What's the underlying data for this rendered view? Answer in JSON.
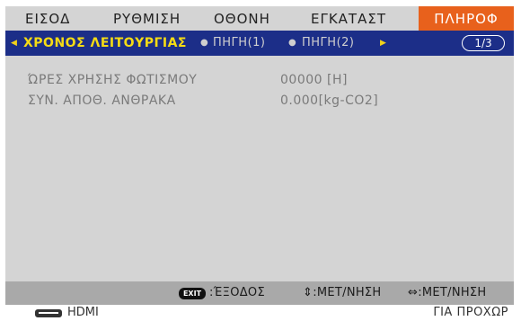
{
  "tabs": [
    {
      "label": "ΕΙΣΟΔ"
    },
    {
      "label": "ΡΥΘΜΙΣΗ"
    },
    {
      "label": "ΟΘΟΝΗ"
    },
    {
      "label": "ΕΓΚΑΤΑΣΤ"
    },
    {
      "label": "ΠΛΗΡΟΦ"
    }
  ],
  "active_tab": "ΠΛΗΡΟΦ",
  "subtabs": {
    "current": "ΧΡΟΝΟΣ ΛΕΙΤΟΥΡΓΙΑΣ",
    "others": [
      "ΠΗΓΗ(1)",
      "ΠΗΓΗ(2)"
    ],
    "page": "1/3"
  },
  "info": [
    {
      "label": "ΏΡΕΣ ΧΡΗΣΗΣ ΦΩΤΙΣΜΟΥ",
      "value": "00000  [H]"
    },
    {
      "label": "ΣΥΝ. ΑΠΟΘ. ΑΝΘΡΑΚΑ",
      "value": "0.000[kg-CO2]"
    }
  ],
  "footer": {
    "exit_key": "EXIT",
    "exit_label": ":ΈΞΟΔΟΣ",
    "move_updown": "⇕:ΜΕΤ/ΝΗΣΗ",
    "move_leftright": "⇔:ΜΕΤ/ΝΗΣΗ"
  },
  "status": {
    "source": "HDMI",
    "hint": "ΓΙΑ ΠΡΟΧΩΡ"
  },
  "colors": {
    "active_tab": "#e8611c",
    "subbar": "#1c2e88",
    "current_subtab": "#f5dc14",
    "menu_background": "#d4d4d4",
    "footer": "#a9a9a9"
  }
}
